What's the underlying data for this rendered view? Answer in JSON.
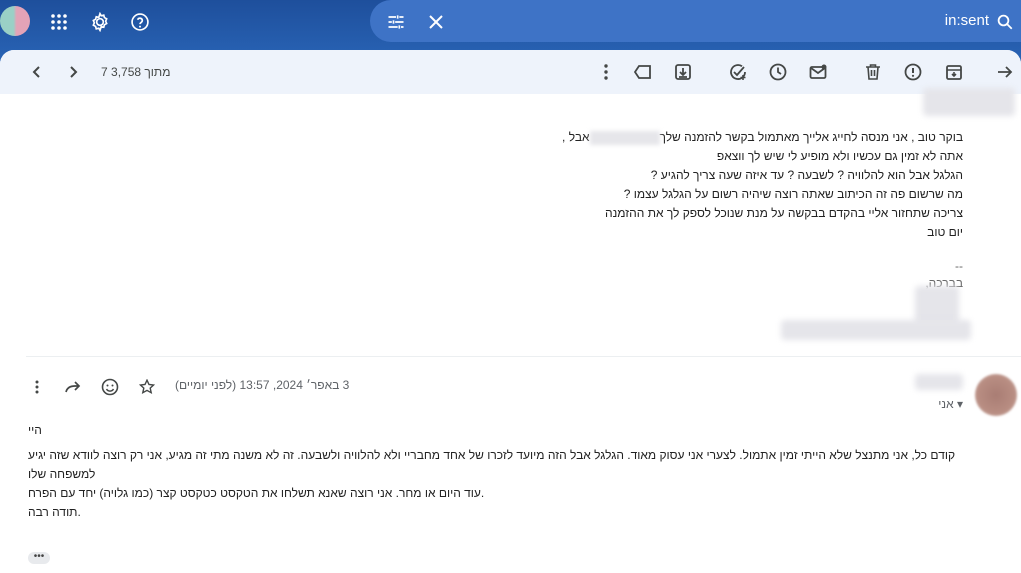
{
  "topbar": {
    "search_query": "in:sent",
    "icons": [
      "apps-grid-icon",
      "settings-gear-icon",
      "help-icon",
      "search-options-icon",
      "clear-search-icon",
      "search-icon"
    ]
  },
  "toolbar": {
    "pager_text": "7 מתוך 3,758"
  },
  "message1": {
    "body_lines": [
      "בוקר טוב , אני מנסה לחייג אלייך מאתמול בקשר להזמנה שלך",
      "אתה לא זמין גם עכשיו ולא מופיע לי שיש לך ווצאפ",
      "הגלגל אבל הוא להלוויה ? לשבעה ? עד איזה שעה צריך להגיע ?",
      "מה שרשום פה זה הכיתוב שאתה רוצה שיהיה רשום על הגלגל עצמו ?",
      "צריכה שתחזור אליי בהקדם בבקשה על מנת שנוכל לספק לך את ההזמנה",
      "יום טוב"
    ],
    "line1_suffix": "אבל ,",
    "sig_dash": "--",
    "sig_closing": "בברכה,"
  },
  "message2": {
    "date": "3 באפר׳ 2024, 13:57 (לפני יומיים)",
    "recipient_label": "אני",
    "greeting": "היי",
    "body_lines": [
      "קודם כל, אני מתנצל שלא הייתי זמין אתמול. לצערי אני עסוק מאוד. הגלגל אבל הזה מיועד לזכרו של אחד מחבריי ולא להלוויה ולשבעה. זה לא משנה מתי זה מגיע, אני רק רוצה לוודא שזה יגיע למשפחה שלו",
      ".עוד היום או מחר. אני רוצה שאנא תשלחו את הטקסט כטקסט קצר (כמו גלויה) יחד עם הפרח",
      ".תודה רבה"
    ],
    "more_label": "•••"
  }
}
